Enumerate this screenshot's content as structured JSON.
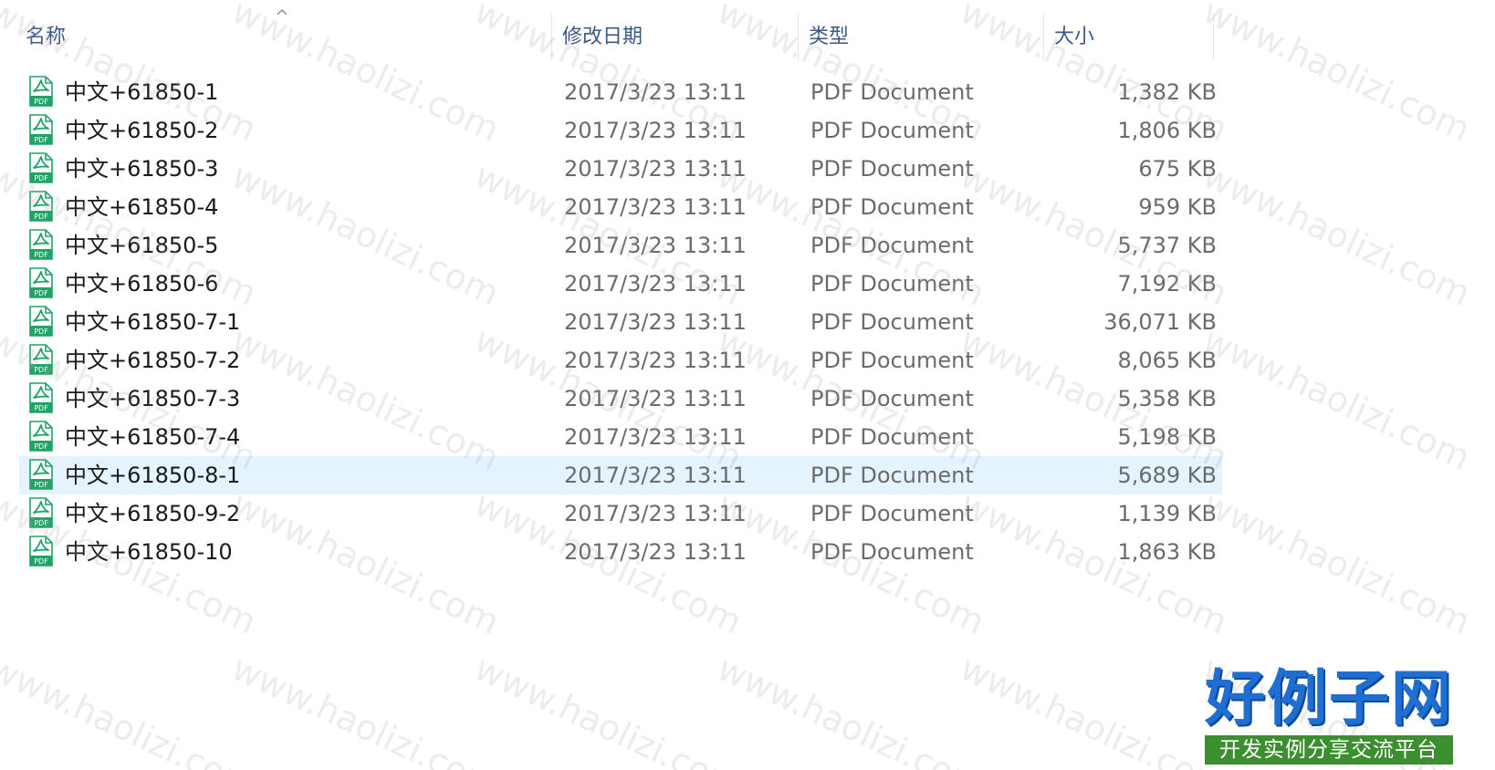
{
  "columns": {
    "name": "名称",
    "date": "修改日期",
    "type": "类型",
    "size": "大小"
  },
  "sort": {
    "column": "name",
    "direction": "ascending",
    "icon": "chevron-up-icon"
  },
  "file_icon": "pdf-file-icon",
  "colors": {
    "header_text": "#3a5a88",
    "selected_row": "#e5f3ff",
    "pdf_icon": "#21a366",
    "logo_blue": "#1e6fd1",
    "logo_green": "#3c8f2e"
  },
  "files": [
    {
      "name": "中文+61850-1",
      "date": "2017/3/23 13:11",
      "type": "PDF Document",
      "size": "1,382 KB"
    },
    {
      "name": "中文+61850-2",
      "date": "2017/3/23 13:11",
      "type": "PDF Document",
      "size": "1,806 KB"
    },
    {
      "name": "中文+61850-3",
      "date": "2017/3/23 13:11",
      "type": "PDF Document",
      "size": "675 KB"
    },
    {
      "name": "中文+61850-4",
      "date": "2017/3/23 13:11",
      "type": "PDF Document",
      "size": "959 KB"
    },
    {
      "name": "中文+61850-5",
      "date": "2017/3/23 13:11",
      "type": "PDF Document",
      "size": "5,737 KB"
    },
    {
      "name": "中文+61850-6",
      "date": "2017/3/23 13:11",
      "type": "PDF Document",
      "size": "7,192 KB"
    },
    {
      "name": "中文+61850-7-1",
      "date": "2017/3/23 13:11",
      "type": "PDF Document",
      "size": "36,071 KB"
    },
    {
      "name": "中文+61850-7-2",
      "date": "2017/3/23 13:11",
      "type": "PDF Document",
      "size": "8,065 KB"
    },
    {
      "name": "中文+61850-7-3",
      "date": "2017/3/23 13:11",
      "type": "PDF Document",
      "size": "5,358 KB"
    },
    {
      "name": "中文+61850-7-4",
      "date": "2017/3/23 13:11",
      "type": "PDF Document",
      "size": "5,198 KB"
    },
    {
      "name": "中文+61850-8-1",
      "date": "2017/3/23 13:11",
      "type": "PDF Document",
      "size": "5,689 KB",
      "selected": true
    },
    {
      "name": "中文+61850-9-2",
      "date": "2017/3/23 13:11",
      "type": "PDF Document",
      "size": "1,139 KB"
    },
    {
      "name": "中文+61850-10",
      "date": "2017/3/23 13:11",
      "type": "PDF Document",
      "size": "1,863 KB"
    }
  ],
  "watermark": "www.haolizi.com",
  "logo": {
    "brand": "好例子网",
    "slogan": "开发实例分享交流平台"
  }
}
